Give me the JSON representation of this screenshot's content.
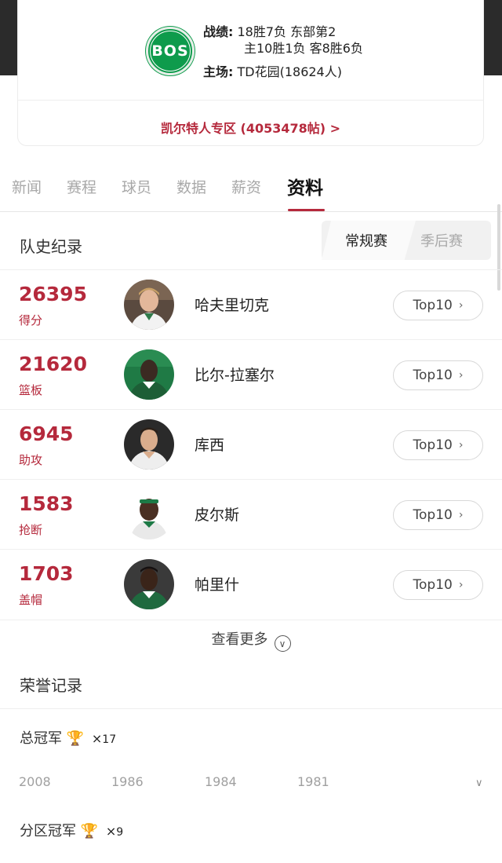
{
  "team": {
    "logo_text": "BOS",
    "record_label": "战绩:",
    "record_line1": "18胜7负 东部第2",
    "record_line2": "主10胜1负 客8胜6负",
    "arena_label": "主场:",
    "arena_value": "TD花园(18624人)",
    "zone_link": "凯尔特人专区 (4053478帖) >"
  },
  "tabs": [
    {
      "label": "新闻",
      "active": false
    },
    {
      "label": "赛程",
      "active": false
    },
    {
      "label": "球员",
      "active": false
    },
    {
      "label": "数据",
      "active": false
    },
    {
      "label": "薪资",
      "active": false
    },
    {
      "label": "资料",
      "active": true
    }
  ],
  "history": {
    "title": "队史纪录",
    "segment": {
      "regular": "常规赛",
      "playoffs": "季后赛"
    },
    "records": [
      {
        "value": "26395",
        "category": "得分",
        "player": "哈夫里切克",
        "button": "Top10"
      },
      {
        "value": "21620",
        "category": "篮板",
        "player": "比尔-拉塞尔",
        "button": "Top10"
      },
      {
        "value": "6945",
        "category": "助攻",
        "player": "库西",
        "button": "Top10"
      },
      {
        "value": "1583",
        "category": "抢断",
        "player": "皮尔斯",
        "button": "Top10"
      },
      {
        "value": "1703",
        "category": "盖帽",
        "player": "帕里什",
        "button": "Top10"
      }
    ],
    "more": "查看更多"
  },
  "honors": {
    "title": "荣誉记录",
    "champion_label": "总冠军",
    "champion_count": "17",
    "champion_years": [
      "2008",
      "1986",
      "1984",
      "1981"
    ],
    "division_label": "分区冠军",
    "division_count": "9",
    "times_symbol": "×"
  },
  "colors": {
    "accent": "#b5293c",
    "logo_green": "#0e9b4c"
  }
}
